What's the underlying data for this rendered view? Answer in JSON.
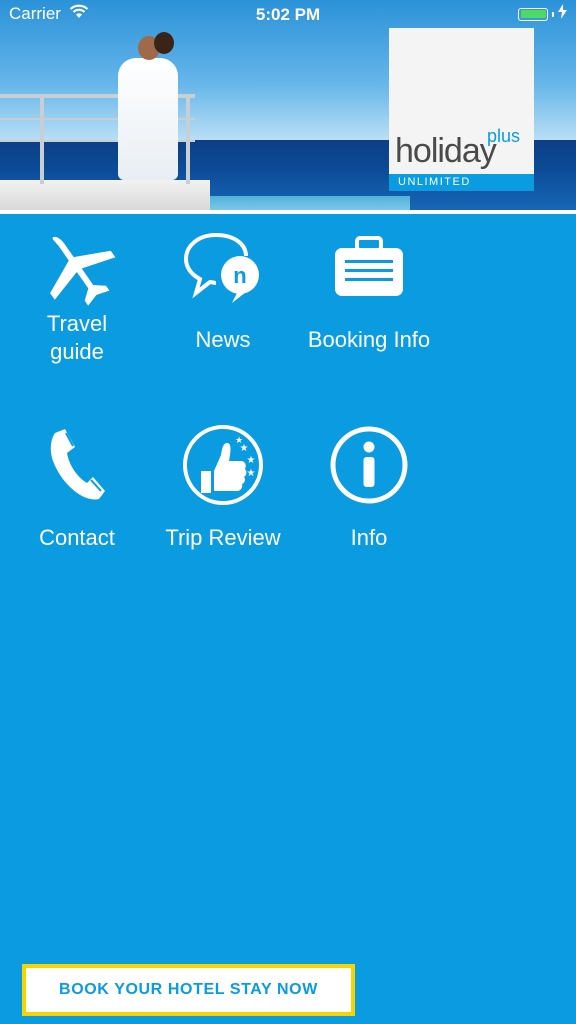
{
  "status_bar": {
    "carrier": "Carrier",
    "time": "5:02 PM"
  },
  "logo": {
    "plus": "plus",
    "word": "holiday",
    "band": "UNLIMITED"
  },
  "tiles": [
    {
      "label_line1": "Travel",
      "label_line2": "guide",
      "icon": "airplane-icon"
    },
    {
      "label": "News",
      "icon": "speech-bubbles-icon"
    },
    {
      "label": "Booking Info",
      "icon": "briefcase-icon"
    },
    {
      "label": "Contact",
      "icon": "phone-icon"
    },
    {
      "label": "Trip Review",
      "icon": "thumbs-up-icon"
    },
    {
      "label": "Info",
      "icon": "info-icon"
    }
  ],
  "cta": {
    "label": "BOOK YOUR HOTEL STAY NOW"
  },
  "colors": {
    "background": "#0a9be1",
    "cta_border": "#f5d400",
    "battery": "#4cd964"
  }
}
